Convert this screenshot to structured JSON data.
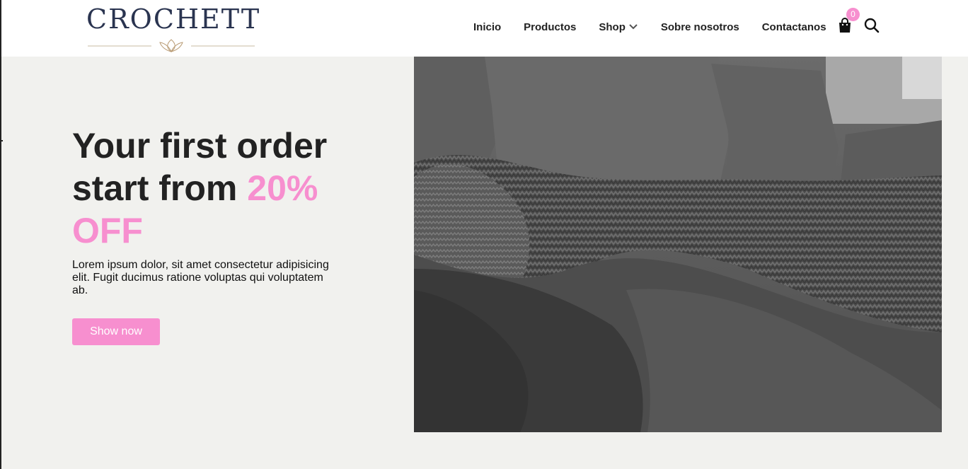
{
  "header": {
    "logo_text": "CROCHETT",
    "nav": [
      {
        "label": "Inicio"
      },
      {
        "label": "Productos"
      },
      {
        "label": "Shop"
      },
      {
        "label": "Sobre nosotros"
      },
      {
        "label": "Contactanos"
      }
    ],
    "cart_count": "0"
  },
  "hero": {
    "title_line1": "Your first order",
    "title_line2": "start from ",
    "title_accent": "20% OFF",
    "text": "Lorem ipsum dolor, sit amet consectetur adipisicing elit. Fugit ducimus ratione voluptas qui voluptatem ab.",
    "button_label": "Show now"
  },
  "icons": {
    "cart": "shopping-bag-icon",
    "search": "search-icon",
    "shop_dropdown": "chevron-down-icon"
  },
  "colors": {
    "accent": "#f78fcf",
    "text": "#222222",
    "logo": "#2a3450",
    "background": "#f1f1ee"
  }
}
